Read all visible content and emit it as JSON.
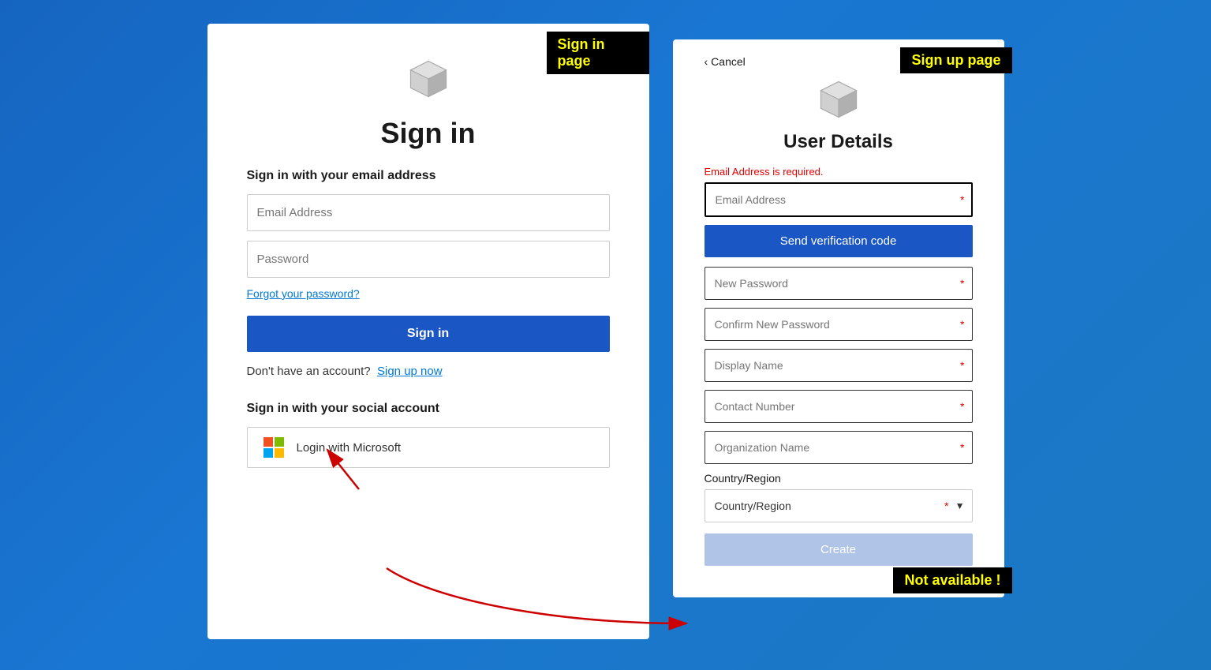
{
  "annotations": {
    "signin_label": "Sign in page",
    "signup_label": "Sign up page",
    "not_available_label": "Not available !"
  },
  "signin": {
    "title": "Sign in",
    "subtitle": "Sign in with your email address",
    "email_placeholder": "Email Address",
    "password_placeholder": "Password",
    "forgot_link": "Forgot your password?",
    "signin_btn": "Sign in",
    "no_account_text": "Don't have an account?",
    "signup_link": "Sign up now",
    "social_title": "Sign in with your social account",
    "microsoft_btn": "Login with Microsoft"
  },
  "signup": {
    "cancel_link": "Cancel",
    "title": "User Details",
    "error_text": "Email Address is required.",
    "email_placeholder": "Email Address",
    "send_code_btn": "Send verification code",
    "new_password_placeholder": "New Password",
    "confirm_password_placeholder": "Confirm New Password",
    "display_name_placeholder": "Display Name",
    "contact_number_placeholder": "Contact Number",
    "org_name_placeholder": "Organization Name",
    "country_label": "Country/Region",
    "country_placeholder": "Country/Region",
    "create_btn": "Create"
  }
}
